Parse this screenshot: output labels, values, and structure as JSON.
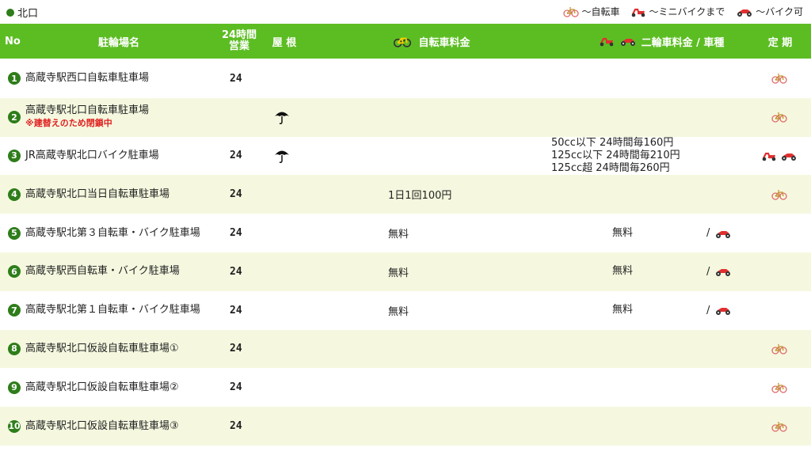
{
  "area_title": "北口",
  "legend": [
    {
      "icon": "bicycle-icon",
      "label": "～自転車"
    },
    {
      "icon": "scooter-icon",
      "label": "～ミニバイクまで"
    },
    {
      "icon": "motorcycle-icon",
      "label": "～バイク可"
    }
  ],
  "header": {
    "no": "No",
    "name": "駐輪場名",
    "hours_line1": "24時間",
    "hours_line2": "営業",
    "roof": "屋 根",
    "bike_fee": "自転車料金",
    "moto_fee": "二輪車料金 / 車種",
    "teiki": "定 期"
  },
  "rows": [
    {
      "no": "1",
      "name": "高蔵寺駅西口自転車駐車場",
      "note": "",
      "hours": "24",
      "roof": false,
      "bike_fee": "",
      "moto_fee": [],
      "moto_types": [],
      "teiki": [
        "bicycle-icon"
      ]
    },
    {
      "no": "2",
      "name": "高蔵寺駅北口自転車駐車場",
      "note": "※建替えのため閉鎖中",
      "hours": "",
      "roof": true,
      "bike_fee": "",
      "moto_fee": [],
      "moto_types": [],
      "teiki": [
        "bicycle-icon"
      ]
    },
    {
      "no": "3",
      "name": "JR高蔵寺駅北口バイク駐車場",
      "note": "",
      "hours": "24",
      "roof": true,
      "bike_fee": "",
      "moto_fee": [
        "50cc以下 24時間毎160円",
        "125cc以下 24時間毎210円",
        "125cc超 24時間毎260円"
      ],
      "moto_types": [],
      "teiki": [
        "scooter-icon",
        "motorcycle-icon"
      ]
    },
    {
      "no": "4",
      "name": "高蔵寺駅北口当日自転車駐車場",
      "note": "",
      "hours": "24",
      "roof": false,
      "bike_fee": "1日1回100円",
      "moto_fee": [],
      "moto_types": [],
      "teiki": [
        "bicycle-icon"
      ]
    },
    {
      "no": "5",
      "name": "高蔵寺駅北第３自転車・バイク駐車場",
      "note": "",
      "hours": "24",
      "roof": false,
      "bike_fee": "無料",
      "moto_fee": [
        "無料"
      ],
      "moto_types": [
        "motorcycle-icon"
      ],
      "teiki": []
    },
    {
      "no": "6",
      "name": "高蔵寺駅西自転車・バイク駐車場",
      "note": "",
      "hours": "24",
      "roof": false,
      "bike_fee": "無料",
      "moto_fee": [
        "無料"
      ],
      "moto_types": [
        "motorcycle-icon"
      ],
      "teiki": []
    },
    {
      "no": "7",
      "name": "高蔵寺駅北第１自転車・バイク駐車場",
      "note": "",
      "hours": "24",
      "roof": false,
      "bike_fee": "無料",
      "moto_fee": [
        "無料"
      ],
      "moto_types": [
        "motorcycle-icon"
      ],
      "teiki": []
    },
    {
      "no": "8",
      "name": "高蔵寺駅北口仮設自転車駐車場①",
      "note": "",
      "hours": "24",
      "roof": false,
      "bike_fee": "",
      "moto_fee": [],
      "moto_types": [],
      "teiki": [
        "bicycle-icon"
      ]
    },
    {
      "no": "9",
      "name": "高蔵寺駅北口仮設自転車駐車場②",
      "note": "",
      "hours": "24",
      "roof": false,
      "bike_fee": "",
      "moto_fee": [],
      "moto_types": [],
      "teiki": [
        "bicycle-icon"
      ]
    },
    {
      "no": "10",
      "name": "高蔵寺駅北口仮設自転車駐車場③",
      "note": "",
      "hours": "24",
      "roof": false,
      "bike_fee": "",
      "moto_fee": [],
      "moto_types": [],
      "teiki": [
        "bicycle-icon"
      ]
    }
  ],
  "moto_slash": "/",
  "colors": {
    "header_bg": "#5cbd23",
    "alt_row": "#f5f8df",
    "number_badge": "#2e7d1a",
    "note": "#e02020",
    "vehicle_red": "#e03030"
  }
}
